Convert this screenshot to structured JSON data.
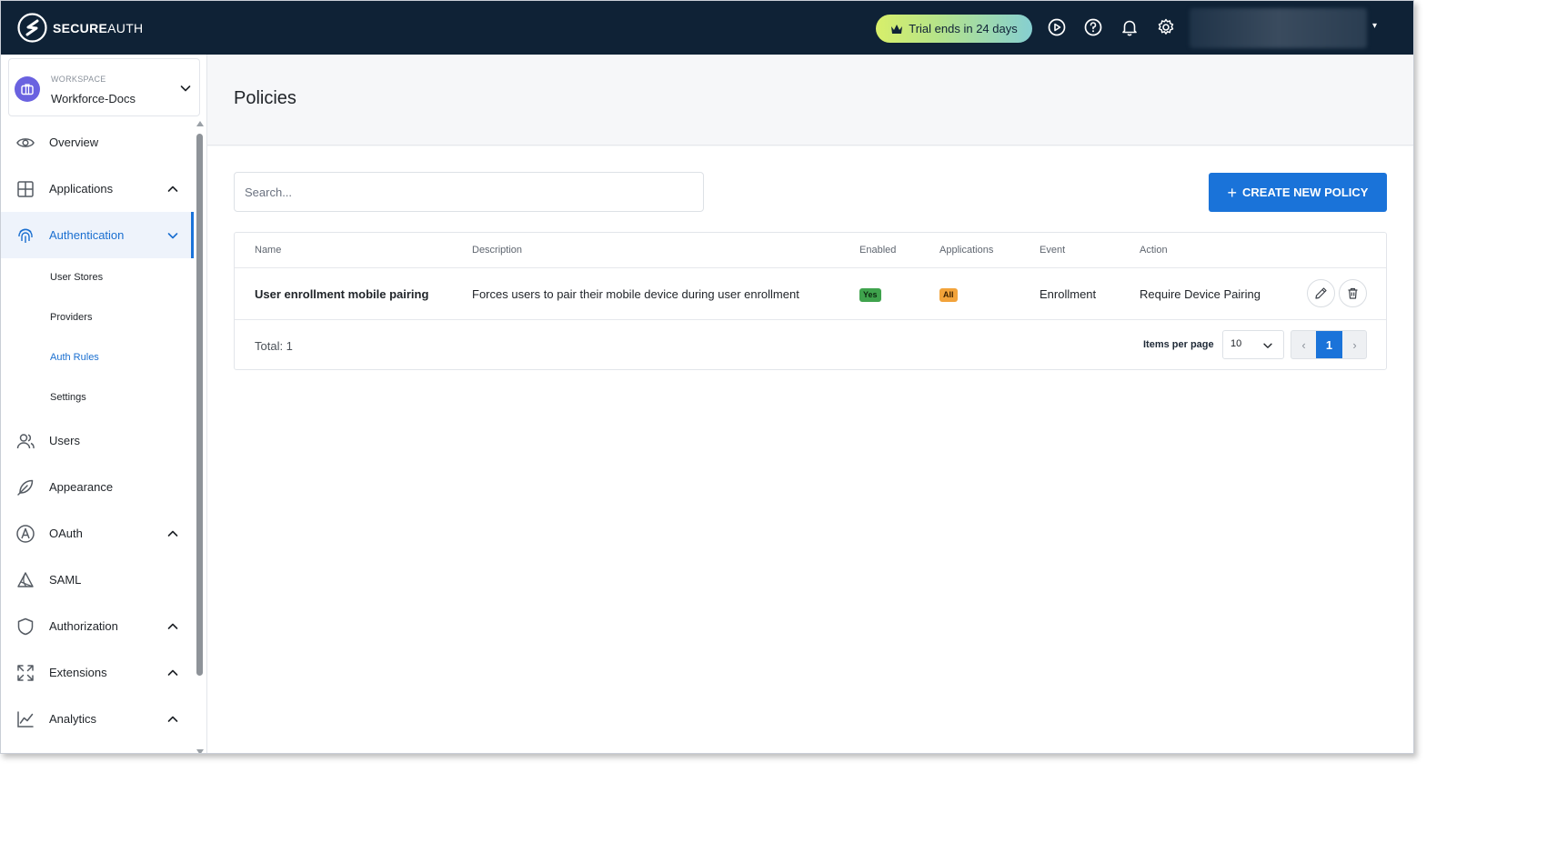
{
  "brand": {
    "name_bold": "SECURE",
    "name_light": "AUTH",
    "logo_icon": "secureauth-logo-icon"
  },
  "topbar": {
    "trial_text": "Trial ends in 24 days",
    "trial_icon": "crown-icon",
    "icons": [
      "play-circle-icon",
      "help-circle-icon",
      "bell-icon",
      "gear-icon"
    ],
    "user_caret": "▾"
  },
  "workspace": {
    "label": "WORKSPACE",
    "name": "Workforce-Docs"
  },
  "sidebar": {
    "items": [
      {
        "label": "Overview",
        "icon": "eye-icon"
      },
      {
        "label": "Applications",
        "icon": "grid-icon",
        "chevron": "up"
      },
      {
        "label": "Authentication",
        "icon": "fingerprint-icon",
        "chevron": "down",
        "active": true
      },
      {
        "label": "Users",
        "icon": "users-icon"
      },
      {
        "label": "Appearance",
        "icon": "feather-icon"
      },
      {
        "label": "OAuth",
        "icon": "oauth-icon",
        "chevron": "up"
      },
      {
        "label": "SAML",
        "icon": "saml-icon"
      },
      {
        "label": "Authorization",
        "icon": "shield-icon",
        "chevron": "up"
      },
      {
        "label": "Extensions",
        "icon": "expand-icon",
        "chevron": "up"
      },
      {
        "label": "Analytics",
        "icon": "chart-line-icon",
        "chevron": "up"
      }
    ],
    "sub_items": [
      {
        "label": "User Stores"
      },
      {
        "label": "Providers"
      },
      {
        "label": "Auth Rules",
        "active": true
      },
      {
        "label": "Settings"
      }
    ]
  },
  "page": {
    "title": "Policies"
  },
  "search": {
    "placeholder": "Search..."
  },
  "create_button": {
    "label": "CREATE NEW POLICY",
    "icon": "plus-icon"
  },
  "table": {
    "columns": [
      "Name",
      "Description",
      "Enabled",
      "Applications",
      "Event",
      "Action"
    ],
    "rows": [
      {
        "name": "User enrollment mobile pairing",
        "description": "Forces users to pair their mobile device during user enrollment",
        "enabled": "Yes",
        "applications": "All",
        "event": "Enrollment",
        "action": "Require Device Pairing"
      }
    ],
    "total": "Total: 1",
    "items_per_page_label": "Items per page",
    "items_per_page": "10",
    "current_page": "1",
    "prev": "‹",
    "next": "›"
  },
  "colors": {
    "topbar": "#0f2236",
    "accent": "#1a73d9",
    "badge_yes": "#3fa34d",
    "badge_all": "#f2a33a",
    "workspace_avatar": "#6a62e0"
  }
}
